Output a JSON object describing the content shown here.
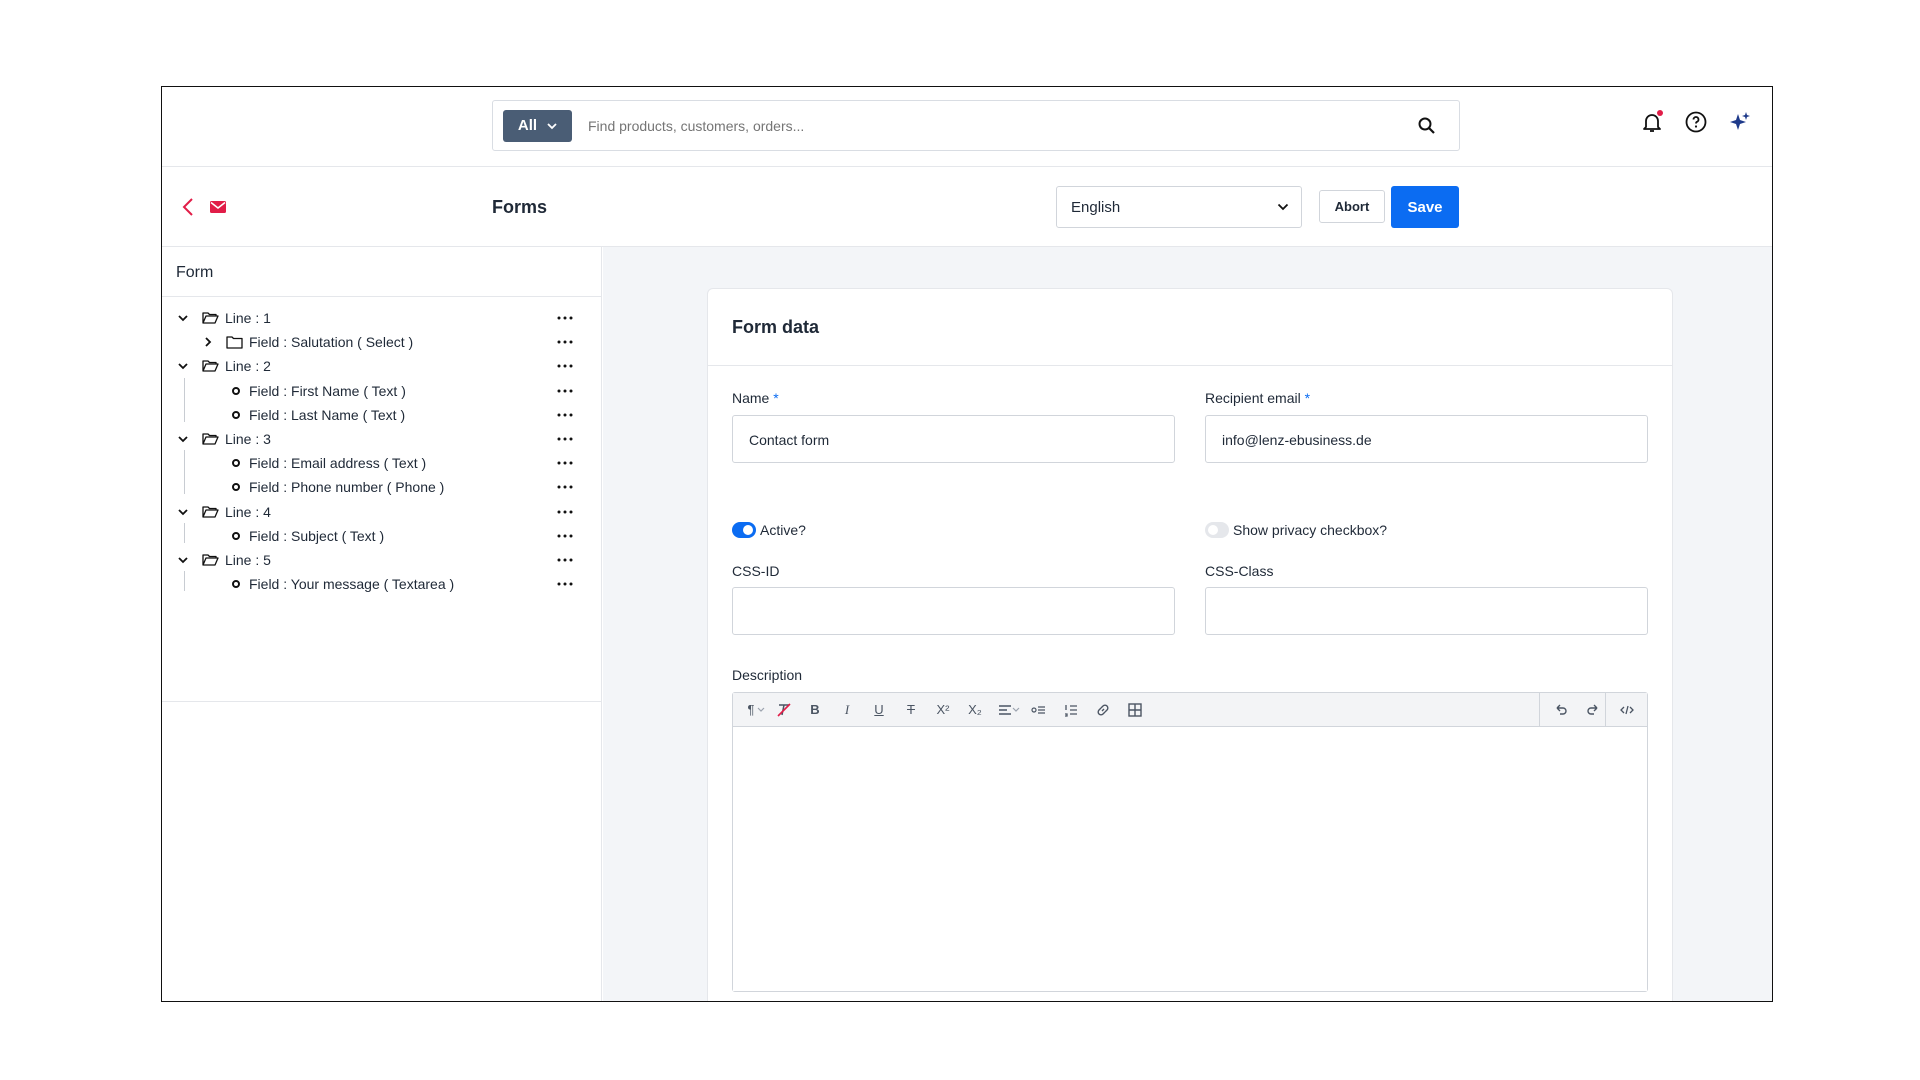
{
  "search": {
    "scope_label": "All",
    "placeholder": "Find products, customers, orders..."
  },
  "header": {
    "title": "Forms",
    "language": "English",
    "abort_label": "Abort",
    "save_label": "Save"
  },
  "sidebar": {
    "title": "Form",
    "rows": [
      {
        "label": "Line : 1",
        "type": "line"
      },
      {
        "label": "Field : Salutation ( Select )",
        "type": "field-folder"
      },
      {
        "label": "Line : 2",
        "type": "line"
      },
      {
        "label": "Field : First Name ( Text )",
        "type": "field"
      },
      {
        "label": "Field : Last Name ( Text )",
        "type": "field"
      },
      {
        "label": "Line : 3",
        "type": "line"
      },
      {
        "label": "Field : Email address ( Text )",
        "type": "field"
      },
      {
        "label": "Field : Phone number ( Phone )",
        "type": "field"
      },
      {
        "label": "Line : 4",
        "type": "line"
      },
      {
        "label": "Field : Subject ( Text )",
        "type": "field"
      },
      {
        "label": "Line : 5",
        "type": "line"
      },
      {
        "label": "Field : Your message ( Textarea )",
        "type": "field"
      }
    ]
  },
  "form": {
    "title": "Form data",
    "name_label": "Name",
    "name_value": "Contact form",
    "recipient_label": "Recipient email",
    "recipient_value": "info@lenz-ebusiness.de",
    "required_mark": "*",
    "active_label": "Active?",
    "active_on": true,
    "privacy_label": "Show privacy checkbox?",
    "privacy_on": false,
    "css_id_label": "CSS-ID",
    "css_id_value": "",
    "css_class_label": "CSS-Class",
    "css_class_value": "",
    "description_label": "Description"
  },
  "colors": {
    "accent": "#0b6cf2",
    "scope_bg": "#4a5d75",
    "brand_red": "#e11d48"
  }
}
